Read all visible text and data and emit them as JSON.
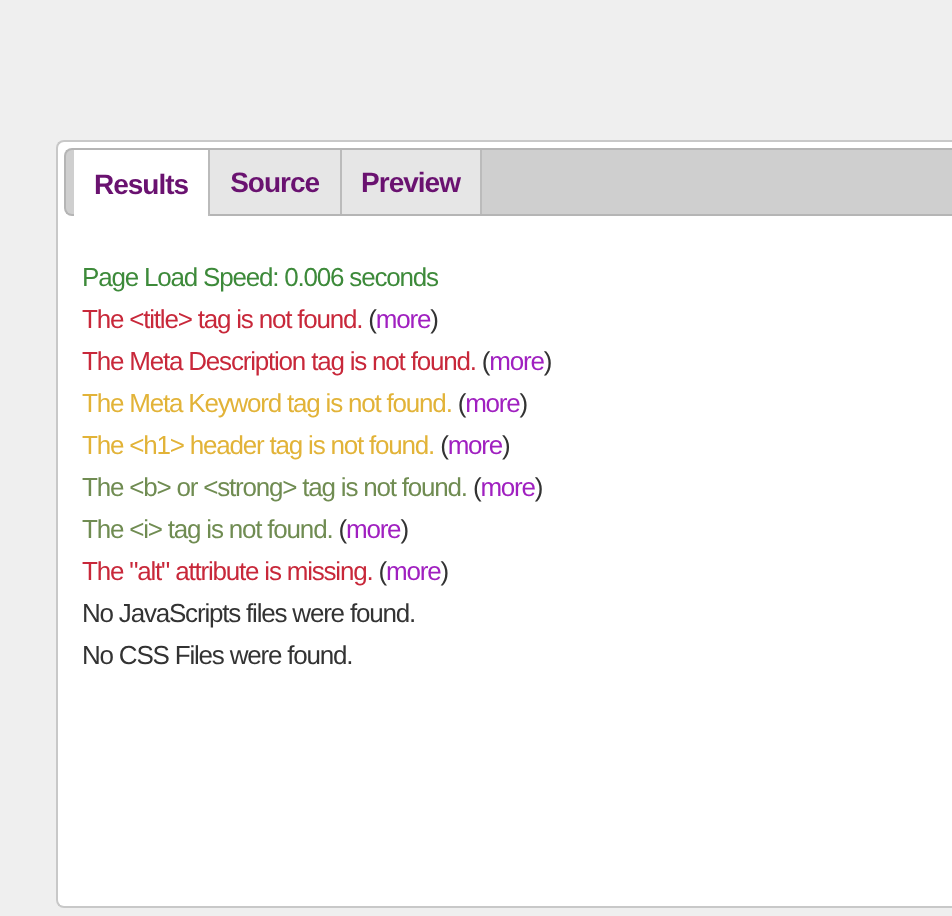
{
  "tabs": [
    {
      "label": "Results",
      "selected": true
    },
    {
      "label": "Source",
      "selected": false
    },
    {
      "label": "Preview",
      "selected": false
    }
  ],
  "results": [
    {
      "color": "#3d8a3a",
      "text": "Page Load Speed: 0.006 seconds"
    },
    {
      "color": "#c8283a",
      "text": "The <title> tag is not found.",
      "link": {
        "open": "(",
        "label": "more",
        "close": ")"
      }
    },
    {
      "color": "#c8283a",
      "text": "The Meta Description tag is not found.",
      "link": {
        "open": "(",
        "label": "more",
        "close": ")"
      }
    },
    {
      "color": "#e2b338",
      "text": "The Meta Keyword tag is not found.",
      "link": {
        "open": "(",
        "label": "more",
        "close": ")"
      }
    },
    {
      "color": "#e2b338",
      "text": "The <h1> header tag is not found.",
      "link": {
        "open": "(",
        "label": "more",
        "close": ")"
      }
    },
    {
      "color": "#708c52",
      "text": "The <b> or <strong> tag is not found.",
      "link": {
        "open": "(",
        "label": "more",
        "close": ")"
      }
    },
    {
      "color": "#708c52",
      "text": "The <i> tag is not found.",
      "link": {
        "open": "(",
        "label": "more",
        "close": ")"
      }
    },
    {
      "color": "#c8283a",
      "text": "The \"alt\" attribute is missing.",
      "link": {
        "open": "(",
        "label": "more",
        "close": ")"
      }
    },
    {
      "color": "#333333",
      "text": "No JavaScripts files were found."
    },
    {
      "color": "#333333",
      "text": "No CSS Files were found."
    }
  ]
}
